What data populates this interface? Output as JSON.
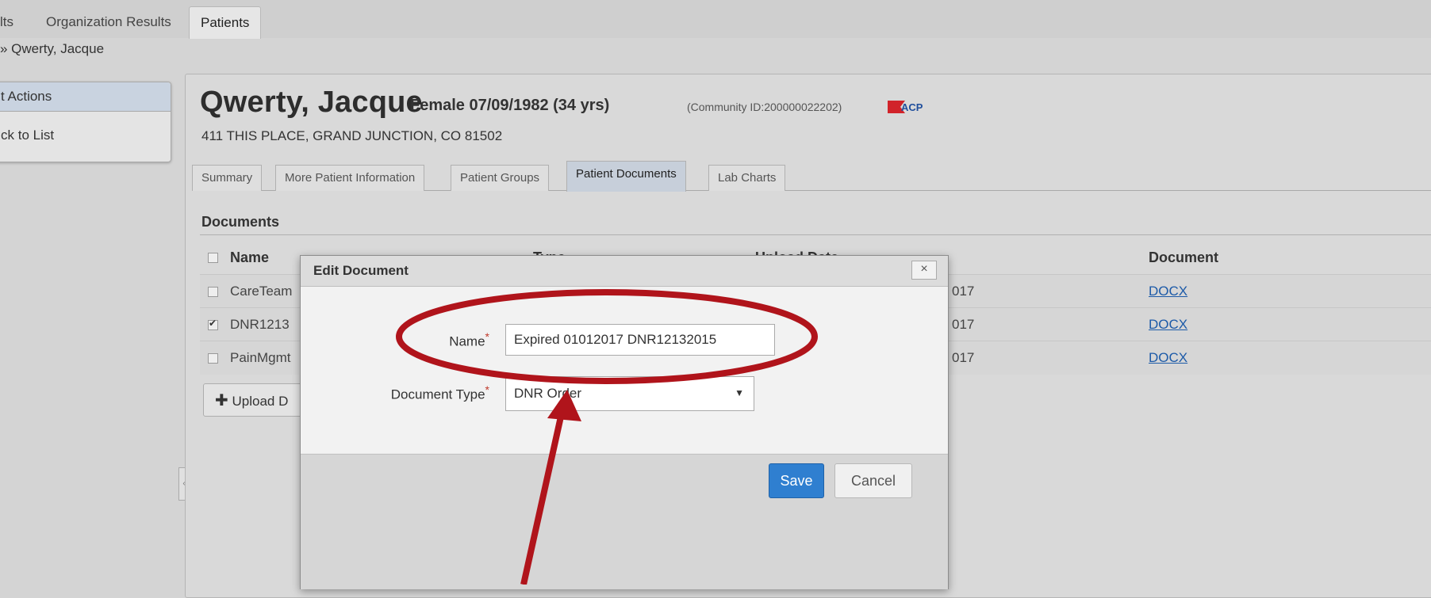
{
  "top_tabs": {
    "partial_results": "lts",
    "org_results": "Organization Results",
    "patients": "Patients"
  },
  "breadcrumb": "» Qwerty, Jacque",
  "actions_panel": {
    "header": "t Actions",
    "back": "ck to List"
  },
  "patient": {
    "name": "Qwerty, Jacque",
    "gender_dob": "Female  07/09/1982 (34 yrs)",
    "community_id": "(Community ID:200000022202)",
    "logo_text": "ACP",
    "address": "411 THIS PLACE, GRAND JUNCTION, CO 81502"
  },
  "patient_tabs": [
    "Summary",
    "More Patient Information",
    "Patient Groups",
    "Patient Documents",
    "Lab Charts"
  ],
  "documents": {
    "title": "Documents",
    "col_name": "Name",
    "col_type": "Type",
    "col_upload": "Upload Date",
    "col_document": "Document",
    "rows": [
      {
        "name": "CareTeam",
        "date_tail": "017",
        "doc": "DOCX",
        "checked": false
      },
      {
        "name": "DNR1213",
        "date_tail": "017",
        "doc": "DOCX",
        "checked": true
      },
      {
        "name": "PainMgmt",
        "date_tail": "017",
        "doc": "DOCX",
        "checked": false
      }
    ],
    "upload_button": "Upload D"
  },
  "modal": {
    "title": "Edit Document",
    "close_symbol": "×",
    "name_label": "Name",
    "name_value": "Expired 01012017 DNR12132015",
    "type_label": "Document Type",
    "type_value": "DNR Order",
    "required_mark": "*",
    "save": "Save",
    "cancel": "Cancel"
  },
  "colors": {
    "annotation": "#b0141b",
    "accent_blue": "#2f7fd0",
    "link": "#1c5aa8"
  },
  "icons": {
    "upload": "plus-icon",
    "select": "caret-down-icon",
    "close": "close-icon"
  }
}
